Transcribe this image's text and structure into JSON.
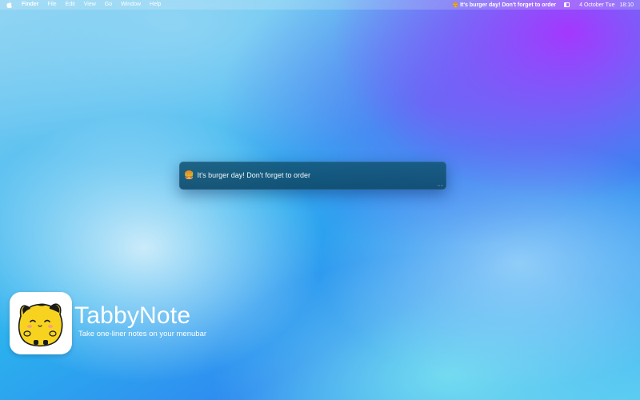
{
  "menubar": {
    "apple_icon": "apple-icon",
    "items": [
      {
        "label": "Finder"
      },
      {
        "label": "File"
      },
      {
        "label": "Edit"
      },
      {
        "label": "View"
      },
      {
        "label": "Go"
      },
      {
        "label": "Window"
      },
      {
        "label": "Help"
      }
    ],
    "note_emoji": "🍔",
    "note_text": "It's burger day! Don't forget to order",
    "status_icon": "sidebar-icon",
    "date": "4 October Tue",
    "time": "18:10"
  },
  "note_window": {
    "emoji": "🍔",
    "text": "It's burger day! Don't forget to order",
    "background_color": "#0f4a6c"
  },
  "branding": {
    "app_name": "TabbyNote",
    "tagline": "Take one-liner notes on your menubar",
    "icon": "tabby-cat-icon",
    "mascot_color": "#f7d320"
  }
}
